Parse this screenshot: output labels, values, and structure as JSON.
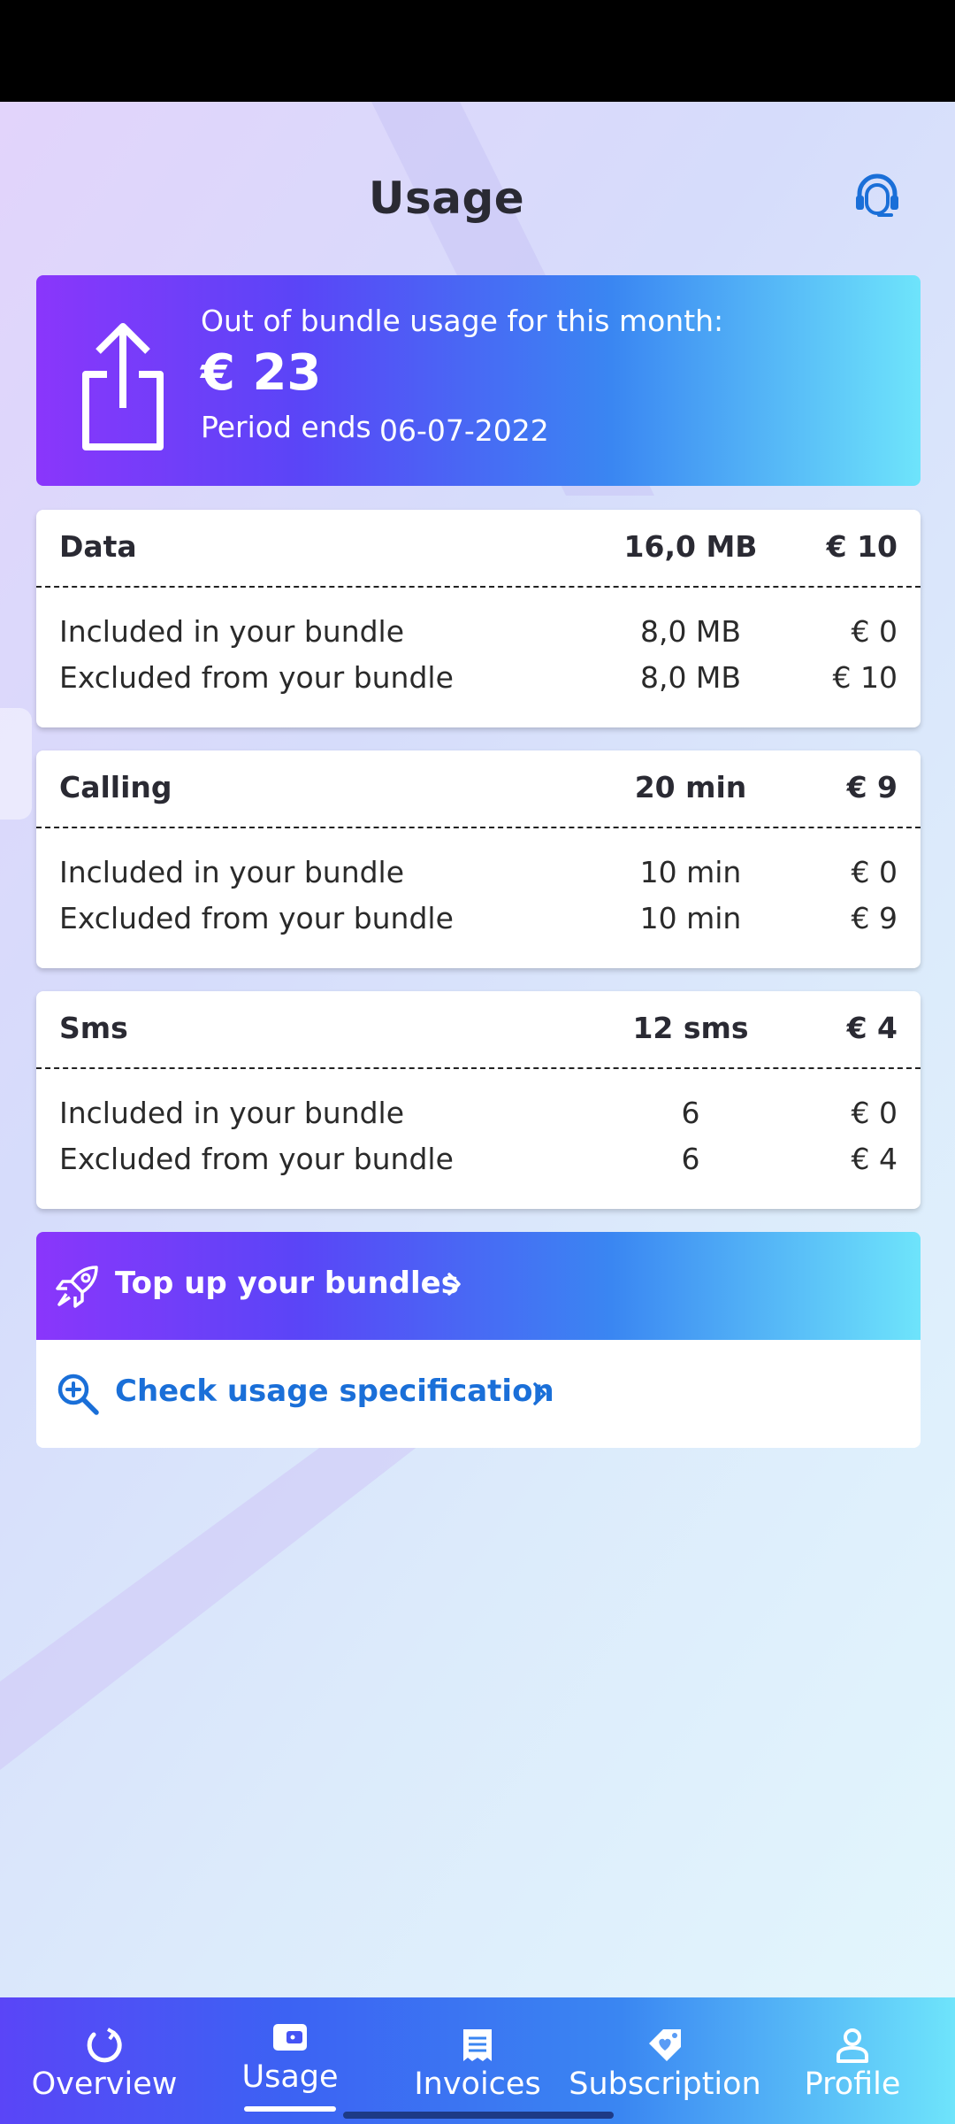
{
  "header": {
    "title": "Usage"
  },
  "banner": {
    "label": "Out of bundle usage for this month:",
    "amount": "€ 23",
    "period_label": "Period ends",
    "period_date": "06-07-2022"
  },
  "cards": [
    {
      "name": "Data",
      "qty": "16,0 MB",
      "cost": "€ 10",
      "rows": [
        {
          "label": "Included in your bundle",
          "qty": "8,0 MB",
          "cost": "€ 0"
        },
        {
          "label": "Excluded from your bundle",
          "qty": "8,0 MB",
          "cost": "€ 10"
        }
      ]
    },
    {
      "name": "Calling",
      "qty": "20 min",
      "cost": "€ 9",
      "rows": [
        {
          "label": "Included in your bundle",
          "qty": "10 min",
          "cost": "€ 0"
        },
        {
          "label": "Excluded from your bundle",
          "qty": "10 min",
          "cost": "€ 9"
        }
      ]
    },
    {
      "name": "Sms",
      "qty": "12 sms",
      "cost": "€ 4",
      "rows": [
        {
          "label": "Included in your bundle",
          "qty": "6",
          "cost": "€ 0"
        },
        {
          "label": "Excluded from your bundle",
          "qty": "6",
          "cost": "€ 4"
        }
      ]
    }
  ],
  "actions": {
    "topup_label": "Top up your bundles",
    "check_label": "Check usage specification"
  },
  "nav": {
    "items": [
      {
        "label": "Overview",
        "icon": "refresh-circle-icon"
      },
      {
        "label": "Usage",
        "icon": "wallet-icon",
        "active": true
      },
      {
        "label": "Invoices",
        "icon": "receipt-icon"
      },
      {
        "label": "Subscription",
        "icon": "tag-heart-icon"
      },
      {
        "label": "Profile",
        "icon": "person-icon"
      }
    ]
  },
  "colors": {
    "accent_blue": "#1a6fd8",
    "gradient_start": "#8a36fb",
    "gradient_end": "#6ee4fb"
  }
}
